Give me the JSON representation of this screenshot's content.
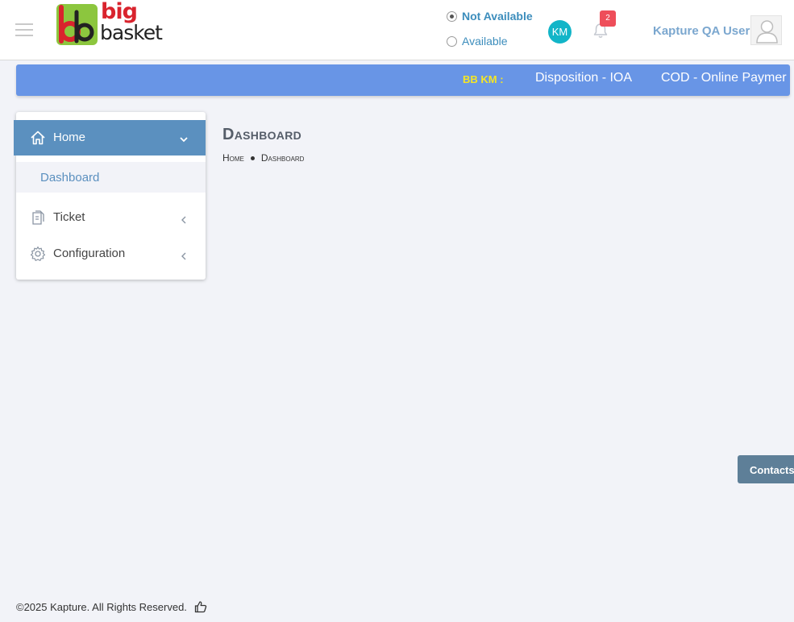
{
  "header": {
    "logo": {
      "line1": "big",
      "line2": "basket"
    },
    "status": {
      "not_available_label": "Not Available",
      "available_label": "Available",
      "selected": "Not Available"
    },
    "km_avatar": "KM",
    "notifications": {
      "count": "2",
      "icon": "bell-icon"
    },
    "user_name": "Kapture QA User",
    "menu_icon": "hamburger-icon"
  },
  "ticker": {
    "label": "BB KM :",
    "items": [
      "Disposition - IOA",
      "COD - Online Paymer"
    ]
  },
  "sidebar": {
    "home": {
      "label": "Home",
      "icon": "home-icon",
      "expanded": true
    },
    "submenu": [
      {
        "label": "Dashboard",
        "active": true
      }
    ],
    "items": [
      {
        "label": "Ticket",
        "icon": "document-icon"
      },
      {
        "label": "Configuration",
        "icon": "gear-icon"
      }
    ]
  },
  "main": {
    "title": "Dashboard",
    "breadcrumb": [
      "Home",
      "Dashboard"
    ]
  },
  "contacts_label": "Contacts",
  "footer": {
    "copyright": "©2025 Kapture. All Rights Reserved.",
    "icon": "thumbs-up-icon"
  },
  "colors": {
    "header_bg": "#ffffff",
    "ticker_bg": "#6895e6",
    "sidebar_active": "#5b90bf",
    "page_bg": "#f2f3f8",
    "accent_blue": "#3c8dbc",
    "badge_red": "#ee4e5a",
    "km_teal": "#12b5c8"
  }
}
